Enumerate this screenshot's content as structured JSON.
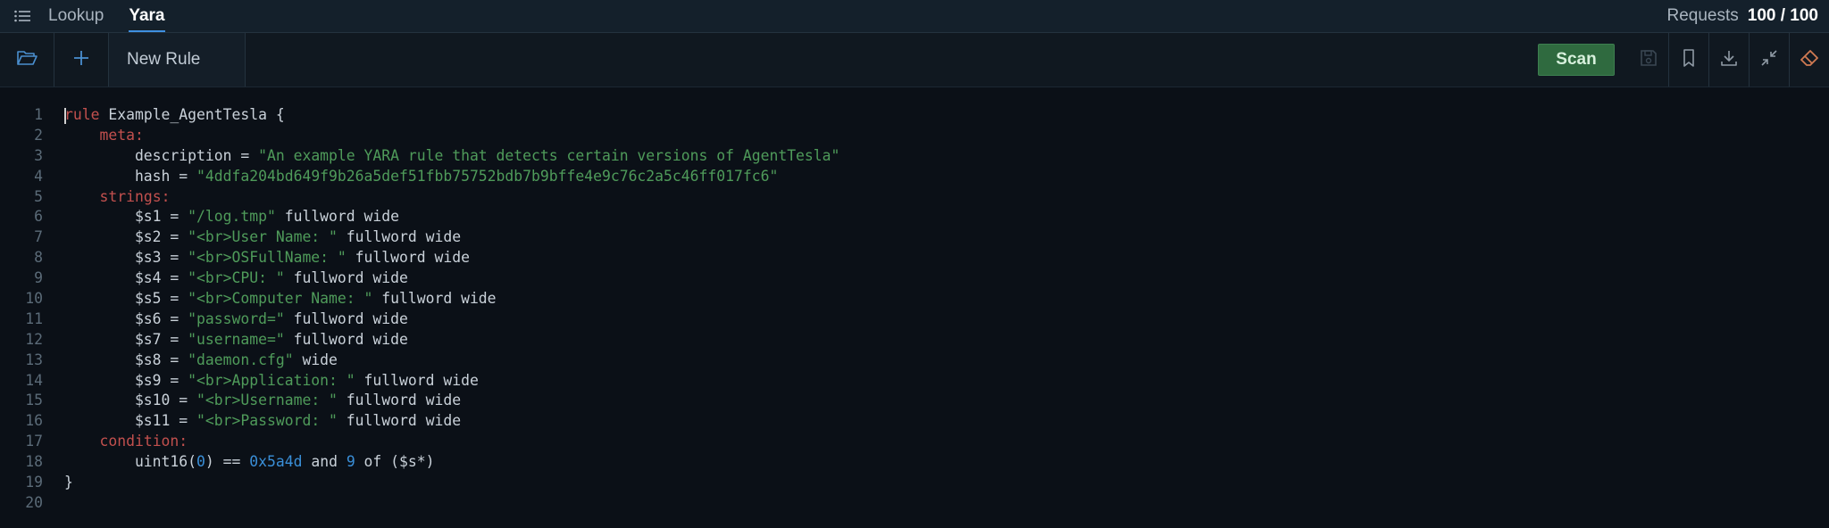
{
  "topbar": {
    "tabs": [
      "Lookup",
      "Yara"
    ],
    "active_tab": "Yara",
    "requests_label": "Requests",
    "requests_value": "100 / 100"
  },
  "toolbar": {
    "tab_label": "New Rule",
    "scan_label": "Scan",
    "icons": [
      "folder-open-icon",
      "plus-icon",
      "save-icon",
      "bookmark-icon",
      "download-icon",
      "collapse-icon",
      "eraser-icon"
    ]
  },
  "editor": {
    "lines": [
      {
        "n": "1",
        "tokens": [
          {
            "t": "rule",
            "c": "kw"
          },
          {
            "t": " Example_AgentTesla {",
            "c": ""
          }
        ]
      },
      {
        "n": "2",
        "tokens": [
          {
            "t": "    ",
            "c": ""
          },
          {
            "t": "meta",
            "c": "kw"
          },
          {
            "t": ":",
            "c": "kw"
          }
        ]
      },
      {
        "n": "3",
        "tokens": [
          {
            "t": "        description = ",
            "c": ""
          },
          {
            "t": "\"An example YARA rule that detects certain versions of AgentTesla\"",
            "c": "str"
          }
        ]
      },
      {
        "n": "4",
        "tokens": [
          {
            "t": "        hash = ",
            "c": ""
          },
          {
            "t": "\"4ddfa204bd649f9b26a5def51fbb75752bdb7b9bffe4e9c76c2a5c46ff017fc6\"",
            "c": "str"
          }
        ]
      },
      {
        "n": "5",
        "tokens": [
          {
            "t": "    ",
            "c": ""
          },
          {
            "t": "strings",
            "c": "kw"
          },
          {
            "t": ":",
            "c": "kw"
          }
        ]
      },
      {
        "n": "6",
        "tokens": [
          {
            "t": "        $s1 = ",
            "c": ""
          },
          {
            "t": "\"/log.tmp\"",
            "c": "str"
          },
          {
            "t": " fullword wide",
            "c": ""
          }
        ]
      },
      {
        "n": "7",
        "tokens": [
          {
            "t": "        $s2 = ",
            "c": ""
          },
          {
            "t": "\"<br>User Name: \"",
            "c": "str"
          },
          {
            "t": " fullword wide",
            "c": ""
          }
        ]
      },
      {
        "n": "8",
        "tokens": [
          {
            "t": "        $s3 = ",
            "c": ""
          },
          {
            "t": "\"<br>OSFullName: \"",
            "c": "str"
          },
          {
            "t": " fullword wide",
            "c": ""
          }
        ]
      },
      {
        "n": "9",
        "tokens": [
          {
            "t": "        $s4 = ",
            "c": ""
          },
          {
            "t": "\"<br>CPU: \"",
            "c": "str"
          },
          {
            "t": " fullword wide",
            "c": ""
          }
        ]
      },
      {
        "n": "10",
        "tokens": [
          {
            "t": "        $s5 = ",
            "c": ""
          },
          {
            "t": "\"<br>Computer Name: \"",
            "c": "str"
          },
          {
            "t": " fullword wide",
            "c": ""
          }
        ]
      },
      {
        "n": "11",
        "tokens": [
          {
            "t": "        $s6 = ",
            "c": ""
          },
          {
            "t": "\"password=\"",
            "c": "str"
          },
          {
            "t": " fullword wide",
            "c": ""
          }
        ]
      },
      {
        "n": "12",
        "tokens": [
          {
            "t": "        $s7 = ",
            "c": ""
          },
          {
            "t": "\"username=\"",
            "c": "str"
          },
          {
            "t": " fullword wide",
            "c": ""
          }
        ]
      },
      {
        "n": "13",
        "tokens": [
          {
            "t": "        $s8 = ",
            "c": ""
          },
          {
            "t": "\"daemon.cfg\"",
            "c": "str"
          },
          {
            "t": " wide",
            "c": ""
          }
        ]
      },
      {
        "n": "14",
        "tokens": [
          {
            "t": "        $s9 = ",
            "c": ""
          },
          {
            "t": "\"<br>Application: \"",
            "c": "str"
          },
          {
            "t": " fullword wide",
            "c": ""
          }
        ]
      },
      {
        "n": "15",
        "tokens": [
          {
            "t": "        $s10 = ",
            "c": ""
          },
          {
            "t": "\"<br>Username: \"",
            "c": "str"
          },
          {
            "t": " fullword wide",
            "c": ""
          }
        ]
      },
      {
        "n": "16",
        "tokens": [
          {
            "t": "        $s11 = ",
            "c": ""
          },
          {
            "t": "\"<br>Password: \"",
            "c": "str"
          },
          {
            "t": " fullword wide",
            "c": ""
          }
        ]
      },
      {
        "n": "17",
        "tokens": [
          {
            "t": "    ",
            "c": ""
          },
          {
            "t": "condition",
            "c": "kw"
          },
          {
            "t": ":",
            "c": "kw"
          }
        ]
      },
      {
        "n": "18",
        "tokens": [
          {
            "t": "        uint16(",
            "c": ""
          },
          {
            "t": "0",
            "c": "num"
          },
          {
            "t": ") == ",
            "c": ""
          },
          {
            "t": "0x5a4d",
            "c": "num"
          },
          {
            "t": " and ",
            "c": ""
          },
          {
            "t": "9",
            "c": "num"
          },
          {
            "t": " of ($s*)",
            "c": ""
          }
        ]
      },
      {
        "n": "19",
        "tokens": [
          {
            "t": "}",
            "c": ""
          }
        ]
      },
      {
        "n": "20",
        "tokens": []
      }
    ]
  },
  "colors": {
    "background": "#0b1017",
    "keyword": "#c2504e",
    "string": "#4f9b5a",
    "number": "#3a8fd8",
    "scan_button": "#2f6a3f",
    "active_tab_underline": "#3f8fe0"
  }
}
